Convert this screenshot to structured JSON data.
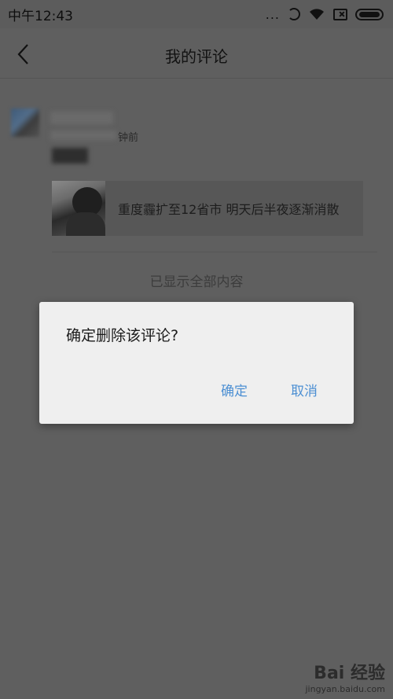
{
  "status_bar": {
    "time": "中午12:43",
    "dots": "..."
  },
  "header": {
    "title": "我的评论"
  },
  "comment": {
    "time_suffix": "钟前",
    "article_title": "重度霾扩至12省市 明天后半夜逐渐消散"
  },
  "list_footer": "已显示全部内容",
  "dialog": {
    "message": "确定删除该评论?",
    "confirm_label": "确定",
    "cancel_label": "取消"
  },
  "watermark": {
    "logo": "Bai 经验",
    "url": "jingyan.baidu.com"
  },
  "colors": {
    "dialog_button": "#4c8fd3",
    "overlay_background": "#5f5f5f"
  }
}
